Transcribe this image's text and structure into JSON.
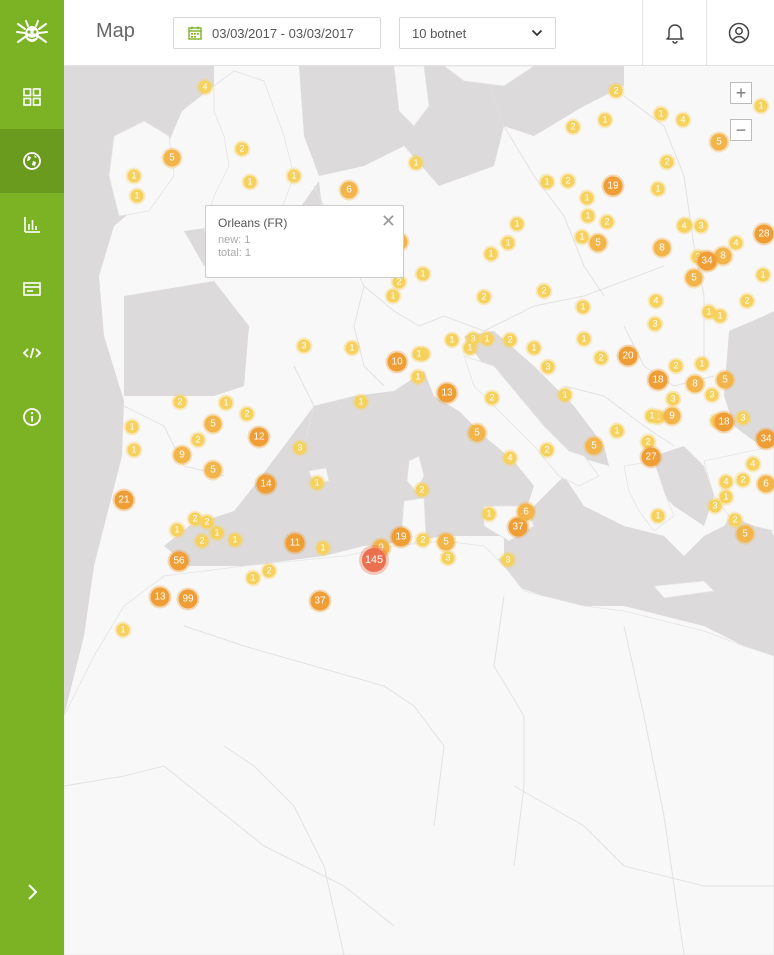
{
  "header": {
    "title": "Map",
    "date_range": "03/03/2017 - 03/03/2017",
    "botnet_select": "10 botnet"
  },
  "sidebar": {
    "items": [
      {
        "icon": "dashboard-icon",
        "active": false
      },
      {
        "icon": "globe-icon",
        "active": true
      },
      {
        "icon": "bar-chart-icon",
        "active": false
      },
      {
        "icon": "card-icon",
        "active": false
      },
      {
        "icon": "code-icon",
        "active": false
      },
      {
        "icon": "info-icon",
        "active": false
      }
    ]
  },
  "map": {
    "zoom_in": "+",
    "zoom_out": "−",
    "popup": {
      "title": "Orleans (FR)",
      "new": "new: 1",
      "total": "total: 1",
      "close": "✕"
    },
    "markers": [
      "4",
      "2",
      "1",
      "4",
      "2",
      "1",
      "1",
      "5",
      "5",
      "2",
      "1",
      "1",
      "6",
      "1",
      "1",
      "2",
      "1",
      "19",
      "2",
      "1",
      "1",
      "1",
      "1",
      "1",
      "1",
      "1",
      "2",
      "1",
      "1",
      "3",
      "1",
      "5",
      "4",
      "8",
      "3",
      "28",
      "4",
      "2",
      "8",
      "5",
      "34",
      "5",
      "1",
      "2",
      "2",
      "1",
      "2",
      "1",
      "4",
      "1",
      "3",
      "1",
      "2",
      "1",
      "1",
      "3",
      "1",
      "1",
      "3",
      "1",
      "2",
      "1",
      "1",
      "1",
      "10",
      "1",
      "2",
      "20",
      "5",
      "2",
      "3",
      "1",
      "8",
      "18",
      "3",
      "1",
      "1",
      "13",
      "1",
      "2",
      "1",
      "1",
      "1",
      "9",
      "18",
      "2",
      "3",
      "2",
      "1",
      "2",
      "5",
      "3",
      "12",
      "1",
      "1",
      "2",
      "9",
      "5",
      "34",
      "3",
      "1",
      "5",
      "4",
      "2",
      "5",
      "27",
      "4",
      "2",
      "6",
      "4",
      "1",
      "1",
      "14",
      "21",
      "2",
      "1",
      "3",
      "2",
      "5",
      "1",
      "2",
      "2",
      "2",
      "1",
      "1",
      "1",
      "37",
      "6",
      "3",
      "1",
      "11",
      "9",
      "19",
      "2",
      "5",
      "3",
      "145",
      "56",
      "2",
      "1",
      "37",
      "13",
      "99",
      "1"
    ],
    "colors": {
      "small": "#f7d15e",
      "medium": "#f3b449",
      "large": "#ef9d35",
      "xlarge": "#ea7050",
      "land": "#f8f8f8",
      "sea": "#dcdadb",
      "sidebar": "#7cb325"
    }
  }
}
